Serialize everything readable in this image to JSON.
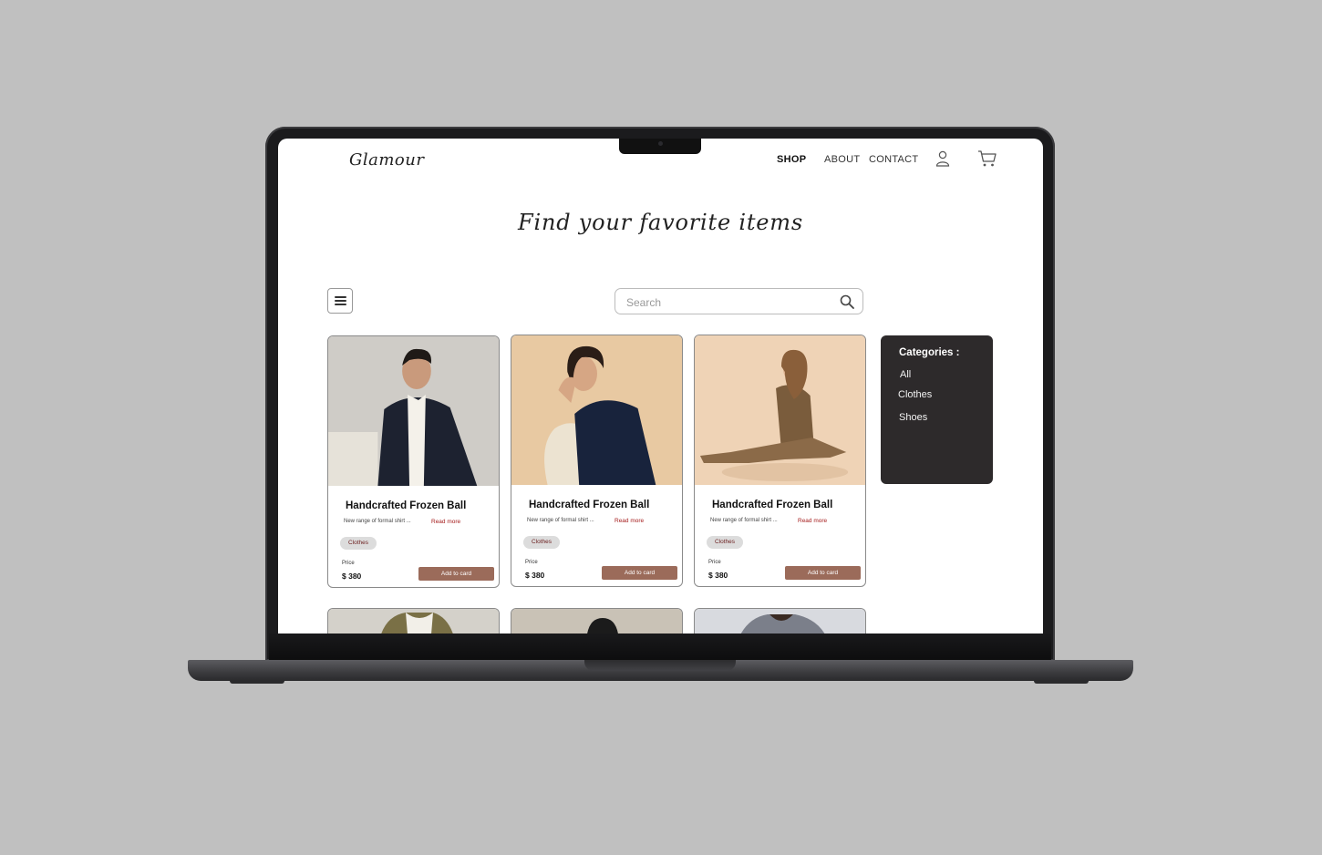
{
  "header": {
    "logo": "Glamour",
    "nav": {
      "shop": "SHOP",
      "about": "ABOUT",
      "contact": "CONTACT"
    },
    "icons": [
      "user-icon",
      "cart-icon"
    ]
  },
  "hero": {
    "title": "Find your favorite items"
  },
  "toolbar": {
    "menu_icon": "hamburger-icon"
  },
  "search": {
    "placeholder": "Search",
    "value": ""
  },
  "products": [
    {
      "title": "Handcrafted Frozen Ball",
      "description": "New range of formal shirt ...",
      "read_more": "Read more",
      "category": "Clothes",
      "price_label": "Price",
      "price": "$ 380",
      "button": "Add to card"
    },
    {
      "title": "Handcrafted Frozen Ball",
      "description": "New range of formal shirt ...",
      "read_more": "Read more",
      "category": "Clothes",
      "price_label": "Price",
      "price": "$ 380",
      "button": "Add to card"
    },
    {
      "title": "Handcrafted Frozen Ball",
      "description": "New range of formal shirt ...",
      "read_more": "Read more",
      "category": "Clothes",
      "price_label": "Price",
      "price": "$ 380",
      "button": "Add to card"
    }
  ],
  "categories": {
    "heading": "Categories :",
    "items": [
      "All",
      "Clothes",
      "Shoes"
    ]
  },
  "colors": {
    "accent_button": "#9b6b5a",
    "read_more": "#a51c1c",
    "sidebar_bg": "#2d2a2b",
    "background": "#c0c0c0"
  }
}
